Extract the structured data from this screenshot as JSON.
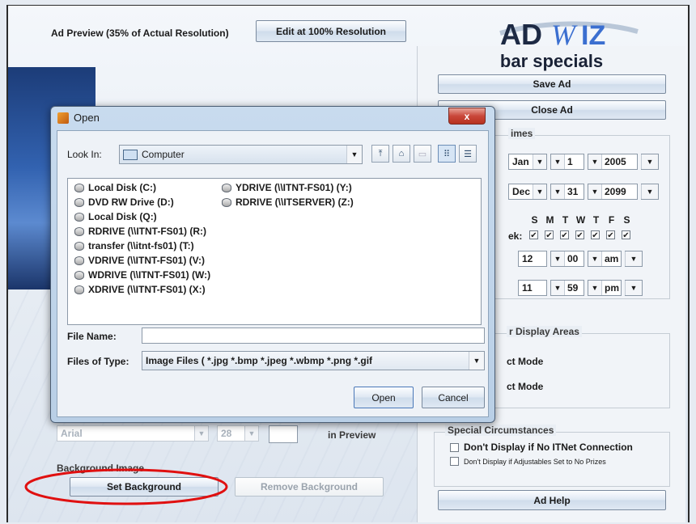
{
  "header": {
    "preview_label": "Ad Preview (35% of Actual Resolution)",
    "edit_button": "Edit at 100% Resolution",
    "logo": "ADWIZ"
  },
  "right_panel": {
    "ad_name": "bar specials",
    "save_button": "Save Ad",
    "close_button": "Close Ad",
    "times_title": "imes",
    "start_date": {
      "month": "Jan",
      "day": "1",
      "year": "2005"
    },
    "end_date": {
      "month": "Dec",
      "day": "31",
      "year": "2099"
    },
    "days_label": "ek:",
    "days": [
      "S",
      "M",
      "T",
      "W",
      "T",
      "F",
      "S"
    ],
    "start_time": {
      "hour": "12",
      "minute": "00",
      "ampm": "am"
    },
    "end_time": {
      "hour": "11",
      "minute": "59",
      "ampm": "pm"
    },
    "display_areas_title": "r Display Areas",
    "mode1": "ct Mode",
    "mode2": "ct Mode",
    "special_title": "Special Circumstances",
    "opt_itnet": "Don't Display if No ITNet Connection",
    "opt_adjustables": "Don't Display if Adjustables Set to No Prizes",
    "help_button": "Ad Help"
  },
  "left_bottom": {
    "font_value": "Arial",
    "size_value": "28",
    "in_preview": "in Preview",
    "background_label": "Background Image",
    "set_bg_button": "Set Background",
    "remove_bg_button": "Remove Background"
  },
  "dialog": {
    "title": "Open",
    "look_in_label": "Look In:",
    "look_in_value": "Computer",
    "files_col1": [
      "Local Disk (C:)",
      "DVD RW Drive (D:)",
      "Local Disk (Q:)",
      "RDRIVE (\\\\ITNT-FS01) (R:)",
      "transfer (\\\\itnt-fs01) (T:)",
      "VDRIVE (\\\\ITNT-FS01) (V:)",
      "WDRIVE (\\\\ITNT-FS01) (W:)",
      "XDRIVE (\\\\ITNT-FS01) (X:)"
    ],
    "files_col2": [
      "YDRIVE (\\\\ITNT-FS01) (Y:)",
      "RDRIVE (\\\\ITSERVER) (Z:)"
    ],
    "file_name_label": "File Name:",
    "file_name_value": "",
    "file_type_label": "Files of Type:",
    "file_type_value": "Image Files ( *.jpg *.bmp *.jpeg *.wbmp *.png *.gif",
    "open_button": "Open",
    "cancel_button": "Cancel",
    "close_glyph": "x"
  },
  "colors": {
    "accent": "#2b55a8",
    "annotation": "#e01010"
  }
}
